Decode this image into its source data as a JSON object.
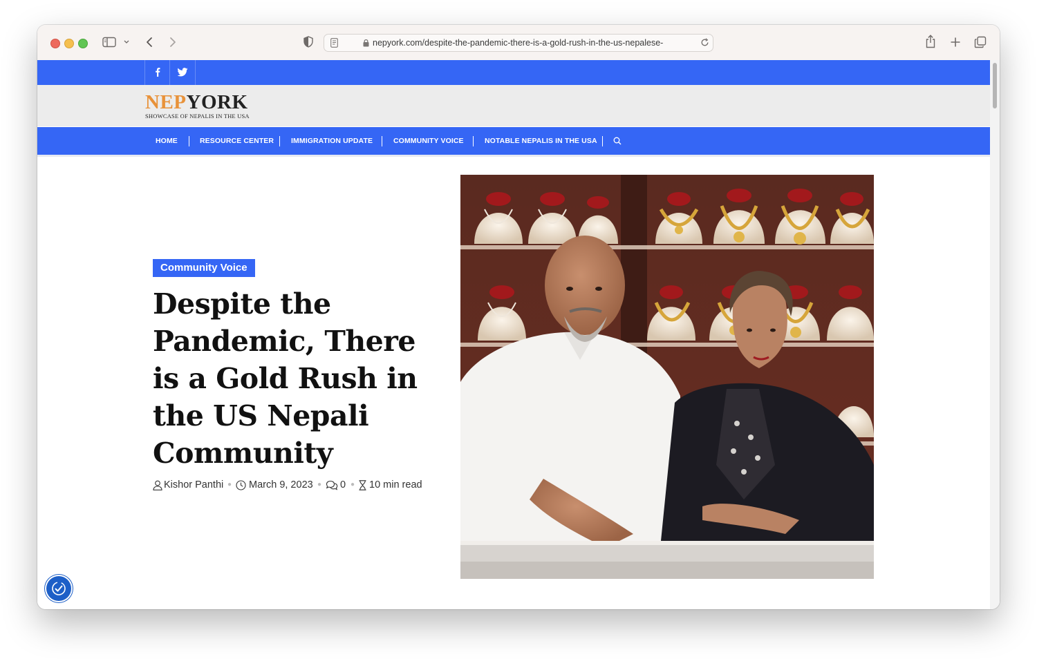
{
  "browser": {
    "url": "nepyork.com/despite-the-pandemic-there-is-a-gold-rush-in-the-us-nepalese-"
  },
  "site": {
    "logo_nep": "NEP",
    "logo_york": "YORK",
    "tagline": "SHOWCASE OF NEPALIS IN THE USA",
    "accent_color": "#3566f5",
    "logo_color": "#e8923a",
    "social_icons": [
      "facebook-icon",
      "twitter-icon"
    ]
  },
  "nav": {
    "items": [
      "HOME",
      "RESOURCE CENTER",
      "IMMIGRATION UPDATE",
      "COMMUNITY VOICE",
      "NOTABLE NEPALIS IN THE USA"
    ],
    "search_icon": "search-icon"
  },
  "article": {
    "category": "Community Voice",
    "title": "Despite the Pandemic, There is a Gold Rush in the US Nepali Community",
    "author": "Kishor Panthi",
    "date": "March 9, 2023",
    "comments": "0",
    "read_time": "10 min read"
  }
}
